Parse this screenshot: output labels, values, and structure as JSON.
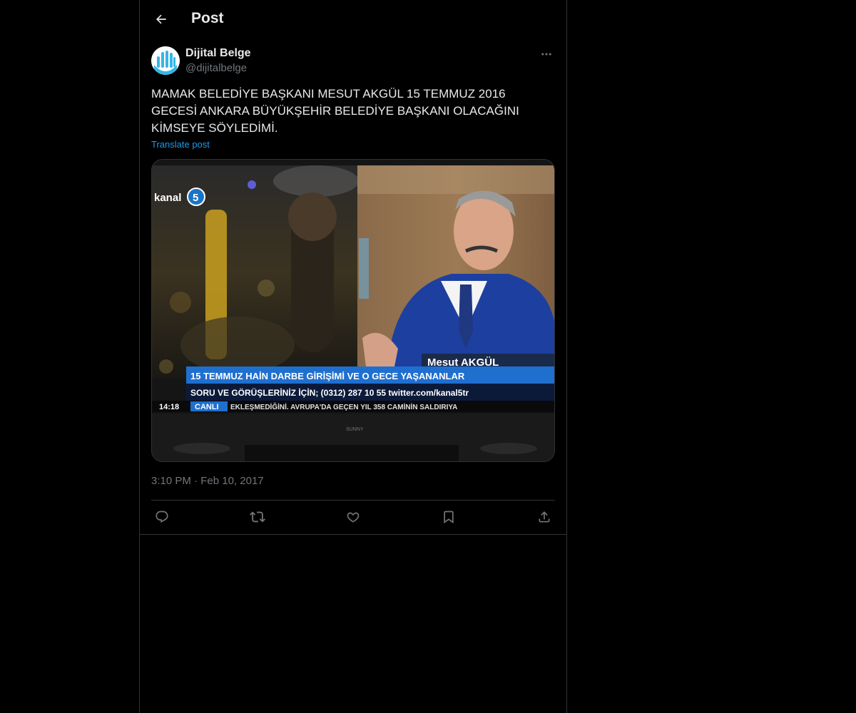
{
  "header": {
    "title": "Post",
    "back_icon": "arrow-left-icon"
  },
  "post": {
    "author": {
      "name": "Dijital Belge",
      "handle": "@dijitalbelge",
      "avatar_icon": "hand-logo-avatar"
    },
    "more_icon": "more-horizontal-icon",
    "text": "MAMAK BELEDİYE BAŞKANI MESUT AKGÜL 15 TEMMUZ 2016 GECESİ ANKARA BÜYÜKŞEHİR BELEDİYE BAŞKANI OLACAĞINI KİMSEYE SÖYLEDİMİ.",
    "translate_label": "Translate post",
    "media": {
      "channel_logo": "kanal5",
      "name_caption": "Mesut AKGÜL",
      "headline": "15 TEMMUZ HAİN DARBE GİRİŞİMİ VE O GECE YAŞANANLAR",
      "subline": "SORU VE GÖRÜŞLERİNİZ İÇİN; (0312) 287 10 55  twitter.com/kanal5tr",
      "clock": "14:18",
      "live_label": "CANLI",
      "ticker": "EKLEŞMEDİĞİNİ. AVRUPA'DA GEÇEN YIL 358 CAMİNİN SALDIRIYA",
      "tv_brand": "SUNNY"
    },
    "time": "3:10 PM",
    "separator": "·",
    "date": "Feb 10, 2017"
  },
  "actions": [
    {
      "name": "reply",
      "icon": "reply-icon"
    },
    {
      "name": "repost",
      "icon": "repost-icon"
    },
    {
      "name": "like",
      "icon": "heart-icon"
    },
    {
      "name": "bookmark",
      "icon": "bookmark-icon"
    },
    {
      "name": "share",
      "icon": "share-icon"
    }
  ],
  "colors": {
    "background": "#000000",
    "text": "#e7e9ea",
    "muted": "#71767b",
    "link": "#1d9bf0",
    "border": "#2f3336"
  }
}
